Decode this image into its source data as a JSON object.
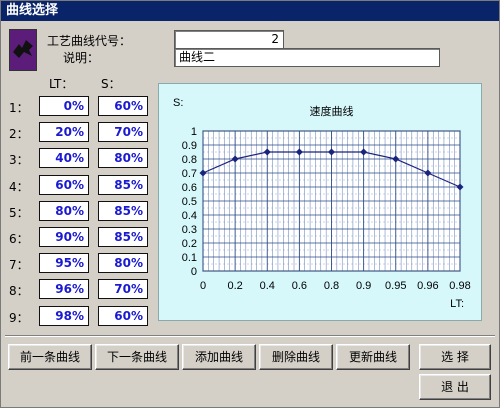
{
  "window": {
    "title": "曲线选择"
  },
  "form": {
    "code_label": "工艺曲线代号：",
    "code_value": "2",
    "desc_label": "说明：",
    "desc_value": "曲线二"
  },
  "columns": {
    "lt": "LT：",
    "s": "S："
  },
  "rows": [
    {
      "idx": "1：",
      "lt": "0%",
      "s": "60%"
    },
    {
      "idx": "2：",
      "lt": "20%",
      "s": "70%"
    },
    {
      "idx": "3：",
      "lt": "40%",
      "s": "80%"
    },
    {
      "idx": "4：",
      "lt": "60%",
      "s": "85%"
    },
    {
      "idx": "5：",
      "lt": "80%",
      "s": "85%"
    },
    {
      "idx": "6：",
      "lt": "90%",
      "s": "85%"
    },
    {
      "idx": "7：",
      "lt": "95%",
      "s": "80%"
    },
    {
      "idx": "8：",
      "lt": "96%",
      "s": "70%"
    },
    {
      "idx": "9：",
      "lt": "98%",
      "s": "60%"
    }
  ],
  "buttons": {
    "prev": "前一条曲线",
    "next": "下一条曲线",
    "add": "添加曲线",
    "delete": "删除曲线",
    "update": "更新曲线",
    "select": "选 择",
    "exit": "退 出"
  },
  "chart_data": {
    "type": "line",
    "title": "速度曲线",
    "ylabel": "S:",
    "xlabel": "LT:",
    "categories": [
      "0",
      "0.2",
      "0.4",
      "0.6",
      "0.8",
      "0.9",
      "0.95",
      "0.96",
      "0.98"
    ],
    "values": [
      0.7,
      0.8,
      0.85,
      0.85,
      0.85,
      0.85,
      0.8,
      0.7,
      0.6
    ],
    "ylim": [
      0,
      1
    ],
    "yticks": [
      "0",
      "0.1",
      "0.2",
      "0.3",
      "0.4",
      "0.5",
      "0.6",
      "0.7",
      "0.8",
      "0.9",
      "1"
    ],
    "grid": true,
    "line_color": "#1a237e",
    "background": "#d6f8fb"
  }
}
